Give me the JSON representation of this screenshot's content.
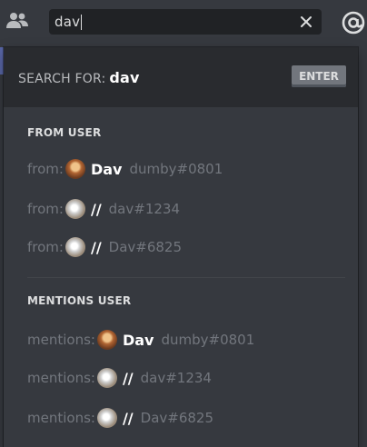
{
  "header": {
    "search_value": "dav",
    "icons": {
      "members": "members-icon",
      "clear": "close-icon",
      "mentions": "at-icon"
    }
  },
  "popout": {
    "search_for_label": "SEARCH FOR:",
    "search_for_query": "dav",
    "enter_label": "ENTER",
    "from_section": {
      "title": "FROM USER",
      "rows": [
        {
          "prefix": "from:",
          "name": "Dav",
          "tag": "dumby#0801"
        },
        {
          "prefix": "from:",
          "name": "//",
          "tag": "dav#1234"
        },
        {
          "prefix": "from:",
          "name": "//",
          "tag": "Dav#6825"
        }
      ]
    },
    "mentions_section": {
      "title": "MENTIONS USER",
      "rows": [
        {
          "prefix": "mentions:",
          "name": "Dav",
          "tag": "dumby#0801"
        },
        {
          "prefix": "mentions:",
          "name": "//",
          "tag": "dav#1234"
        },
        {
          "prefix": "mentions:",
          "name": "//",
          "tag": "Dav#6825"
        }
      ]
    }
  },
  "colors": {
    "background": "#36393f",
    "search_bg": "#202225",
    "header_bg": "#292b2f",
    "muted_text": "#72767d",
    "accent": "#5865a5"
  }
}
